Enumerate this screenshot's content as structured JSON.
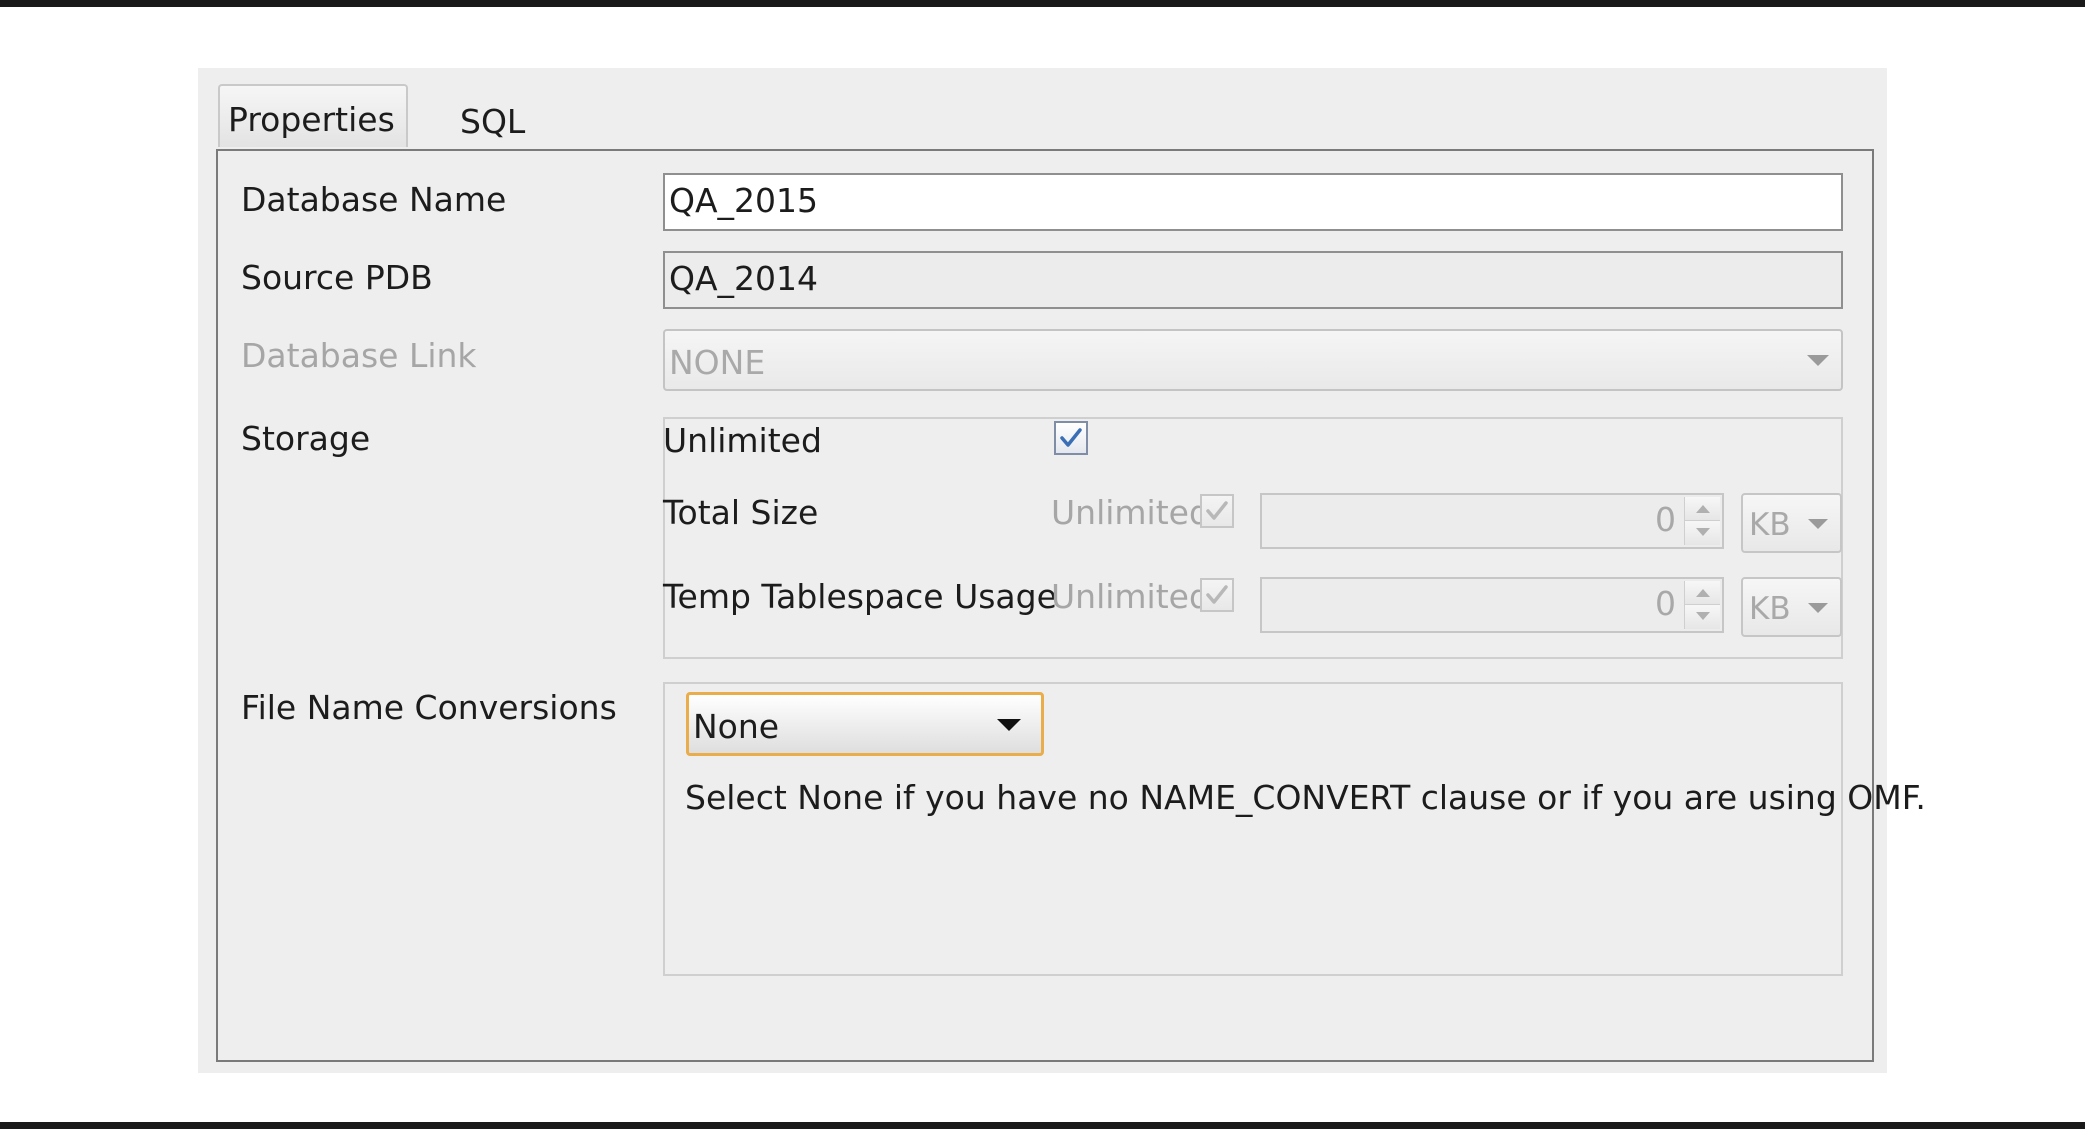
{
  "tabs": [
    {
      "label": "Properties",
      "active": true
    },
    {
      "label": "SQL",
      "active": false
    }
  ],
  "form": {
    "database_name": {
      "label": "Database Name",
      "value": "QA_2015"
    },
    "source_pdb": {
      "label": "Source PDB",
      "value": "QA_2014"
    },
    "database_link": {
      "label": "Database Link",
      "value": "NONE",
      "enabled": false
    },
    "storage": {
      "label": "Storage",
      "unlimited": {
        "label": "Unlimited",
        "checked": true
      },
      "total_size": {
        "label": "Total Size",
        "unlimited_label": "Unlimited",
        "unlimited_checked": true,
        "value": "0",
        "unit": "KB"
      },
      "temp_tablespace": {
        "label": "Temp Tablespace Usage",
        "unlimited_label": "Unlimited",
        "unlimited_checked": true,
        "value": "0",
        "unit": "KB"
      }
    },
    "file_name_conversions": {
      "label": "File Name Conversions",
      "selected": "None",
      "hint": "Select None if you have no NAME_CONVERT clause or if you are using OMF."
    }
  },
  "colors": {
    "focus_border": "#e9ad4c",
    "checkbox_check": "#3a6fb5",
    "disabled_text": "#a6a6a6"
  }
}
